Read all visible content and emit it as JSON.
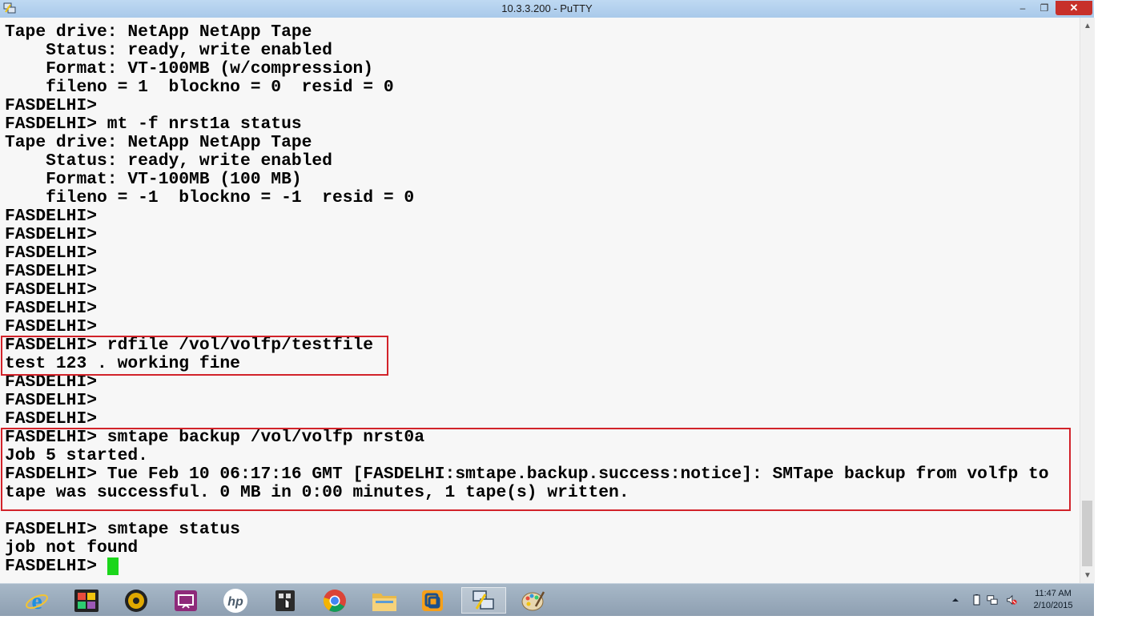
{
  "window": {
    "title": "10.3.3.200 - PuTTY",
    "minimize": "–",
    "maximize": "❐",
    "close": "✕"
  },
  "terminal": {
    "lines": [
      "Tape drive: NetApp NetApp Tape",
      "    Status: ready, write enabled",
      "    Format: VT-100MB (w/compression)",
      "    fileno = 1  blockno = 0  resid = 0",
      "FASDELHI>",
      "FASDELHI> mt -f nrst1a status",
      "Tape drive: NetApp NetApp Tape",
      "    Status: ready, write enabled",
      "    Format: VT-100MB (100 MB)",
      "    fileno = -1  blockno = -1  resid = 0",
      "FASDELHI>",
      "FASDELHI>",
      "FASDELHI>",
      "FASDELHI>",
      "FASDELHI>",
      "FASDELHI>",
      "FASDELHI>",
      "FASDELHI> rdfile /vol/volfp/testfile",
      "test 123 . working fine",
      "FASDELHI>",
      "FASDELHI>",
      "FASDELHI>",
      "FASDELHI> smtape backup /vol/volfp nrst0a",
      "Job 5 started.",
      "FASDELHI> Tue Feb 10 06:17:16 GMT [FASDELHI:smtape.backup.success:notice]: SMTape backup from volfp to",
      "tape was successful. 0 MB in 0:00 minutes, 1 tape(s) written.",
      "",
      "FASDELHI> smtape status",
      "job not found",
      "FASDELHI>"
    ],
    "cursor_color": "#1bd61b",
    "highlight_color": "#d2232a"
  },
  "taskbar": {
    "apps": [
      {
        "name": "internet-explorer-icon"
      },
      {
        "name": "metro-apps-icon"
      },
      {
        "name": "media-player-icon"
      },
      {
        "name": "wireless-display-icon"
      },
      {
        "name": "hp-icon"
      },
      {
        "name": "touch-app-icon"
      },
      {
        "name": "chrome-icon"
      },
      {
        "name": "file-explorer-icon"
      },
      {
        "name": "vmware-icon"
      },
      {
        "name": "putty-icon",
        "active": true
      },
      {
        "name": "paint-icon"
      }
    ],
    "clock_time": "11:47 AM",
    "clock_date": "2/10/2015"
  }
}
